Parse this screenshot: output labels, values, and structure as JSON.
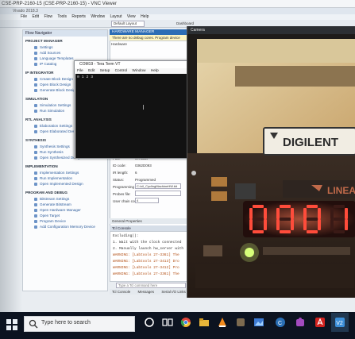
{
  "vnc": {
    "title": "CSE-PRP-2160-15 (CSE-PRP-2160-15) - VNC Viewer"
  },
  "vivado": {
    "titlebar": "Vivado 2018.3",
    "menu": [
      "File",
      "Edit",
      "Flow",
      "Tools",
      "Reports",
      "Window",
      "Layout",
      "View",
      "Help"
    ],
    "layout_select": "Default Layout",
    "dashboard": "Dashboard",
    "flow_navigator": {
      "header": "Flow Navigator",
      "sections": [
        {
          "title": "PROJECT MANAGER",
          "items": [
            "Settings",
            "Add Sources",
            "Language Templates",
            "IP Catalog"
          ]
        },
        {
          "title": "IP INTEGRATOR",
          "items": [
            "Create Block Design",
            "Open Block Design",
            "Generate Block Design"
          ]
        },
        {
          "title": "SIMULATION",
          "items": [
            "Simulation Settings",
            "Run Simulation"
          ]
        },
        {
          "title": "RTL ANALYSIS",
          "items": [
            "Elaboration Settings",
            "Open Elaborated Design"
          ]
        },
        {
          "title": "SYNTHESIS",
          "items": [
            "Synthesis Settings",
            "Run Synthesis",
            "Open Synthesized Design"
          ]
        },
        {
          "title": "IMPLEMENTATION",
          "items": [
            "Implementation Settings",
            "Run Implementation",
            "Open Implemented Design"
          ]
        },
        {
          "title": "PROGRAM AND DEBUG",
          "items": [
            "Bitstream Settings",
            "Generate Bitstream",
            "Open Hardware Manager",
            "Open Target",
            "Program Device",
            "Add Configuration Memory Device"
          ]
        }
      ]
    },
    "hardware_manager": {
      "header": "HARDWARE MANAGER",
      "notice": "There are no debug cores. Program device",
      "panel_label": "Hardware",
      "properties": [
        {
          "key": "Part:",
          "value": "xc7a35t"
        },
        {
          "key": "ID code:",
          "value": "0362D093"
        },
        {
          "key": "IR length:",
          "value": "6"
        },
        {
          "key": "Status:",
          "value": "Programmed"
        },
        {
          "key": "Programming file:",
          "value": ""
        },
        {
          "key": "Probes file:",
          "value": ""
        },
        {
          "key": "User chain count:",
          "value": ""
        }
      ],
      "programming_file": "C:/xil_CyclingMachineHW.bit",
      "refresh_value": "4",
      "props_tabs": "General   Properties"
    },
    "tcl": {
      "header": "Tcl Console",
      "lines": [
        {
          "text": "Excluding():",
          "warn": false
        },
        {
          "text": "1. Wait with the clock connected",
          "warn": false
        },
        {
          "text": "2. Manually launch hw_server with",
          "warn": false
        },
        {
          "text": "WARNING: [Labtools 27-3361] The",
          "warn": true
        },
        {
          "text": "WARNING: [Labtools 27-3413] Dro",
          "warn": true
        },
        {
          "text": "WARNING: [Labtools 27-3412] Pro",
          "warn": true
        },
        {
          "text": "WARNING: [Labtools 27-3361] The",
          "warn": true
        }
      ],
      "input_placeholder": "Type a Tcl command here",
      "bottom_tabs": [
        "Tcl Console",
        "Messages",
        "Serial I/O Links"
      ]
    }
  },
  "teraterm": {
    "title": "COM19 - Tera Term VT",
    "menu": [
      "File",
      "Edit",
      "Setup",
      "Control",
      "Window",
      "Help"
    ],
    "first_line": "0 1 2 3",
    "winbtns": "– ☐ ✕"
  },
  "camera": {
    "title": "Camera",
    "brand": "DIGILENT",
    "chip_brand": "LINEAR",
    "display_digits": [
      "0",
      "0",
      "0",
      "1"
    ]
  },
  "taskbar": {
    "search_placeholder": "Type here to search"
  },
  "colors": {
    "vivado_blue": "#2d6db5",
    "seg_red": "#ff4c3b",
    "taskbar": "#0c1320"
  }
}
